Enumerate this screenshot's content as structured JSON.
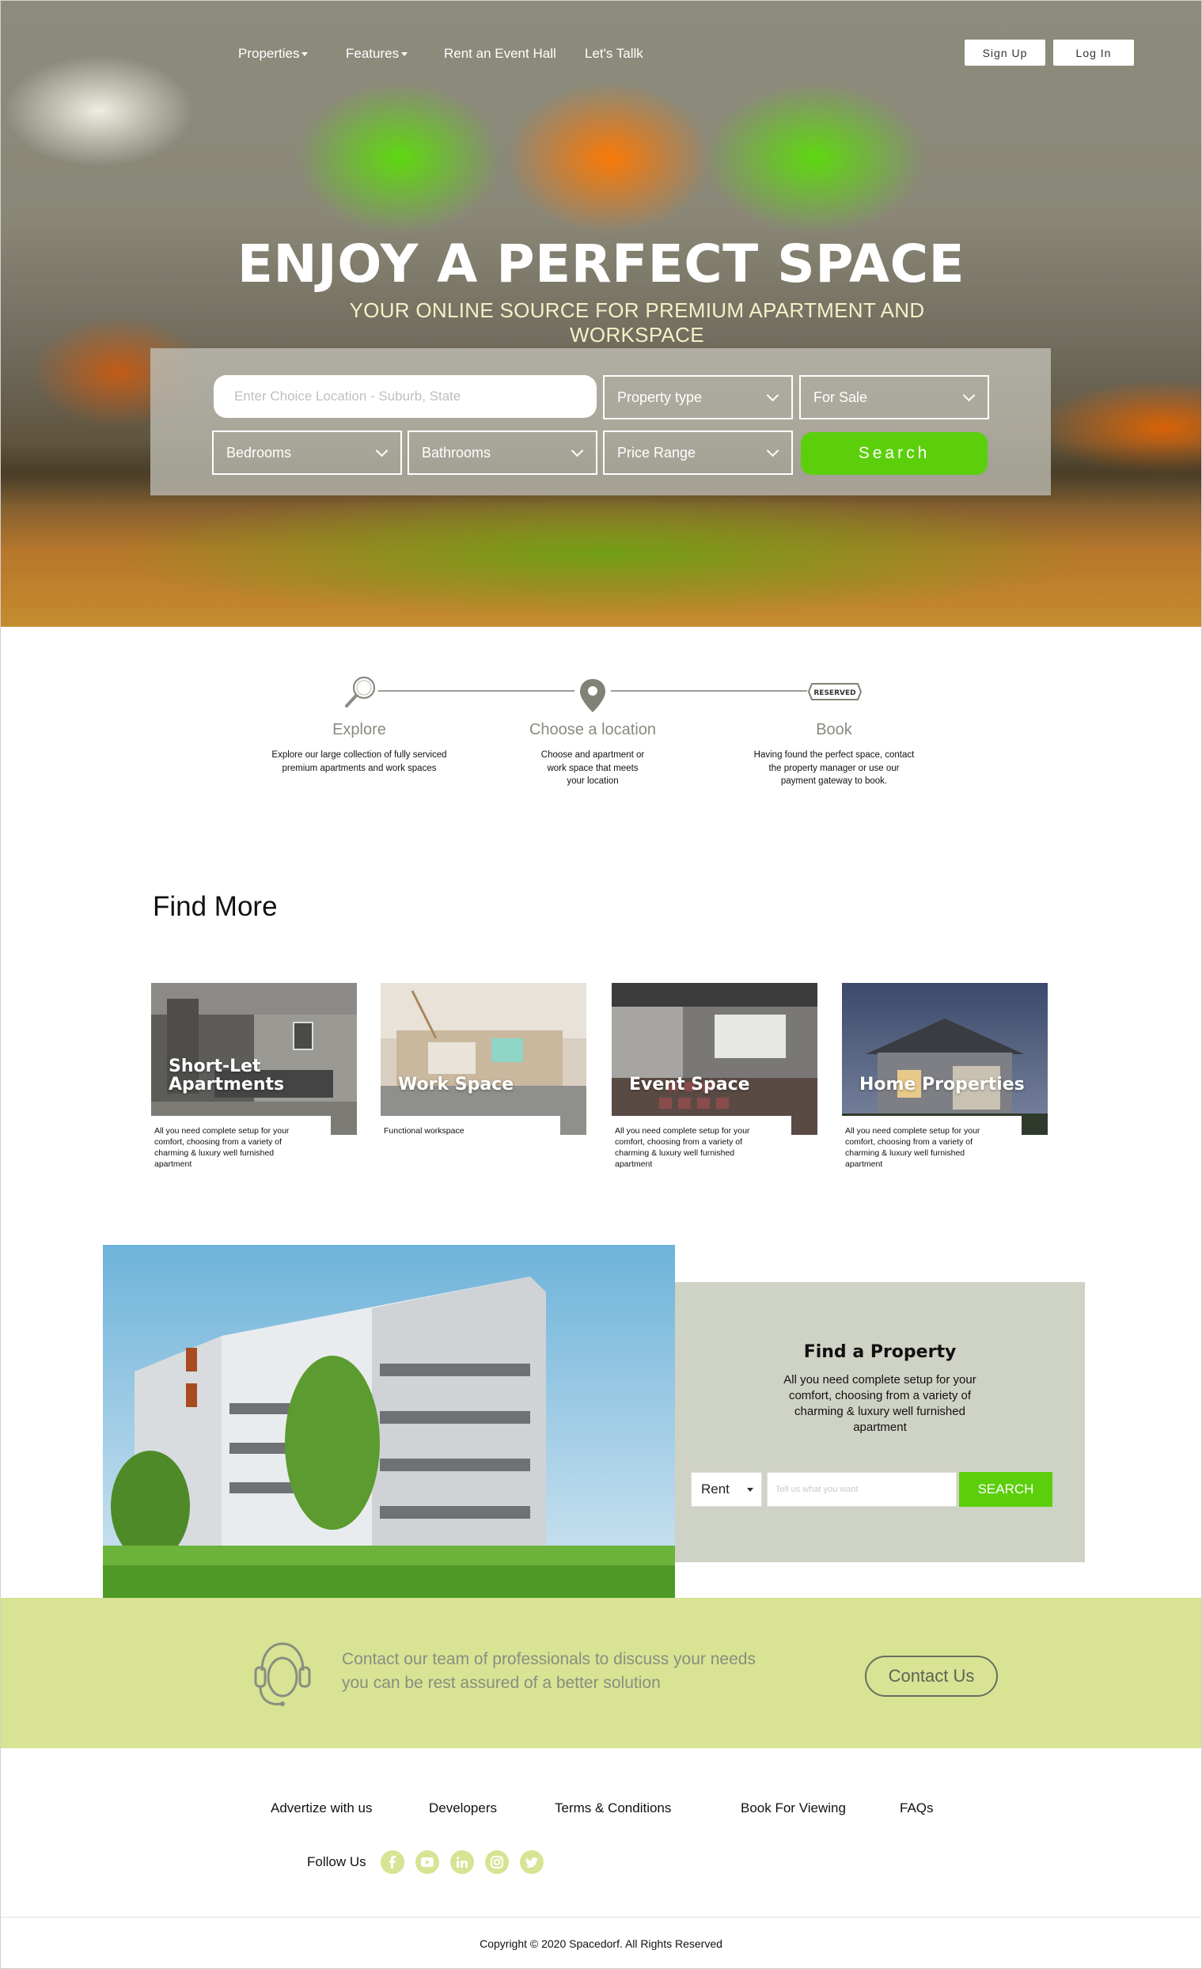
{
  "nav": {
    "items": [
      {
        "label": "Properties",
        "has_caret": true
      },
      {
        "label": "Features",
        "has_caret": true
      },
      {
        "label": "Rent an Event Hall",
        "has_caret": false
      },
      {
        "label": "Let's Tallk",
        "has_caret": false
      }
    ],
    "signup_label": "Sign Up",
    "login_label": "Log In"
  },
  "hero": {
    "title": "ENJOY A PERFECT SPACE",
    "subtitle": "YOUR ONLINE SOURCE FOR PREMIUM APARTMENT AND WORKSPACE"
  },
  "search": {
    "location_placeholder": "Enter Choice Location - Suburb, State",
    "property_type": "Property type",
    "listing_type": "For Sale",
    "bedrooms": "Bedrooms",
    "bathrooms": "Bathrooms",
    "price_range": "Price Range",
    "button_label": "Search"
  },
  "steps": [
    {
      "icon": "magnifier-icon",
      "title": "Explore",
      "desc": "Explore our large collection of fully serviced premium apartments and work spaces"
    },
    {
      "icon": "location-pin-icon",
      "title": "Choose a location",
      "desc": "Choose and apartment or work space that meets your location"
    },
    {
      "icon": "reserved-ticket-icon",
      "badge": "RESERVED",
      "title": "Book",
      "desc": "Having found the perfect space, contact the property manager or use our payment gateway to book."
    }
  ],
  "find_more": {
    "title": "Find More",
    "cards": [
      {
        "label": "Short-Let Apartments",
        "desc": "All you need complete setup for your comfort, choosing from a variety of charming & luxury well furnished apartment"
      },
      {
        "label": "Work Space",
        "desc": "Functional workspace"
      },
      {
        "label": "Event Space",
        "desc": "All you need complete setup for your comfort, choosing from a variety of charming & luxury well furnished apartment"
      },
      {
        "label": "Home Properties",
        "desc": "All you need complete setup for your comfort, choosing from a variety of charming & luxury well furnished apartment"
      }
    ]
  },
  "find_property": {
    "title": "Find a Property",
    "text": "All you need complete setup for your comfort, choosing from a variety of charming & luxury well furnished apartment",
    "select_value": "Rent",
    "input_placeholder": "Tell us what you want",
    "button_label": "SEARCH"
  },
  "contact": {
    "line1": "Contact our team of professionals to discuss your needs",
    "line2": "you can be rest assured of a better solution",
    "button_label": "Contact Us"
  },
  "footer": {
    "links": [
      "Advertize with us",
      "Developers",
      "Terms & Conditions",
      "Book For Viewing",
      "FAQs"
    ],
    "follow_label": "Follow Us",
    "social": [
      "facebook-icon",
      "youtube-icon",
      "linkedin-icon",
      "instagram-icon",
      "twitter-icon"
    ],
    "copyright": "Copyright © 2020 Spacedorf. All Rights Reserved"
  },
  "colors": {
    "accent_green": "#5ccf0c",
    "band_green": "#d8e394",
    "panel_gray": "#cfd3c5"
  }
}
